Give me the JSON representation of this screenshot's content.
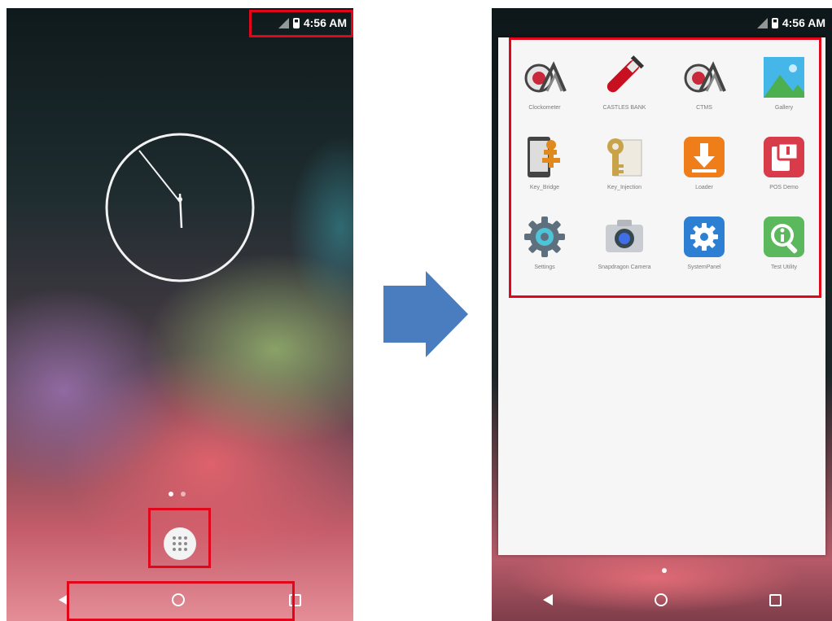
{
  "left_phone": {
    "status_time": "4:56 AM",
    "page_indicator_count": 2,
    "page_indicator_active": 1
  },
  "right_phone": {
    "status_time": "4:56 AM",
    "apps": [
      {
        "label": "Clockometer",
        "icon": "ca-logo-icon"
      },
      {
        "label": "CASTLES BANK",
        "icon": "test-tube-icon"
      },
      {
        "label": "CTMS",
        "icon": "ca-logo-icon"
      },
      {
        "label": "Gallery",
        "icon": "gallery-icon"
      },
      {
        "label": "Key_Bridge",
        "icon": "key-bridge-icon"
      },
      {
        "label": "Key_Injection",
        "icon": "key-injection-icon"
      },
      {
        "label": "Loader",
        "icon": "loader-download-icon"
      },
      {
        "label": "POS Demo",
        "icon": "pos-demo-icon"
      },
      {
        "label": "Settings",
        "icon": "settings-gear-icon"
      },
      {
        "label": "Snapdragon Camera",
        "icon": "camera-icon"
      },
      {
        "label": "SystemPanel",
        "icon": "system-panel-gear-icon"
      },
      {
        "label": "Test Utility",
        "icon": "test-utility-icon"
      }
    ]
  },
  "colors": {
    "highlight": "#e2061b",
    "arrow": "#4a7dbf"
  }
}
